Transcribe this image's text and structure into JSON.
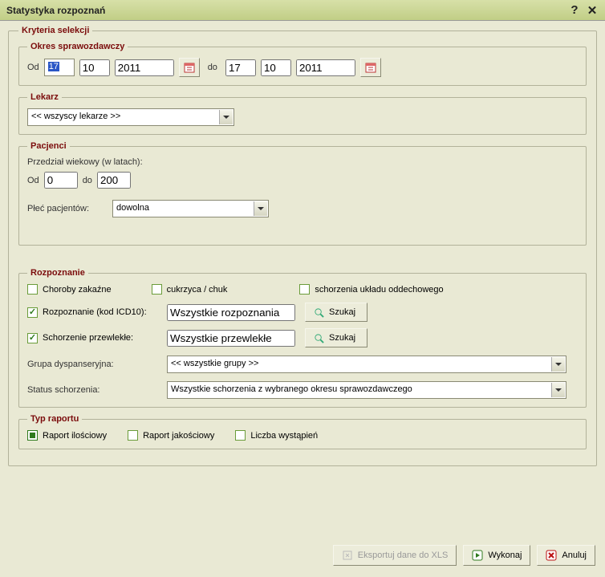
{
  "title": "Statystyka rozpoznań",
  "criteria_legend": "Kryteria selekcji",
  "period": {
    "legend": "Okres sprawozdawczy",
    "from_label": "Od",
    "to_label": "do",
    "from": {
      "d": "17",
      "m": "10",
      "y": "2011"
    },
    "to": {
      "d": "17",
      "m": "10",
      "y": "2011"
    }
  },
  "doctor": {
    "legend": "Lekarz",
    "selected": "<< wszyscy lekarze >>"
  },
  "patients": {
    "legend": "Pacjenci",
    "age_label": "Przedział wiekowy (w latach):",
    "from_label": "Od",
    "to_label": "do",
    "age_from": "0",
    "age_to": "200",
    "sex_label": "Płeć pacjentów:",
    "sex_selected": "dowolna"
  },
  "diagnosis": {
    "legend": "Rozpoznanie",
    "chk_infectious": "Choroby zakaźne",
    "chk_diabetes": "cukrzyca / chuk",
    "chk_respiratory": "schorzenia układu oddechowego",
    "chk_icd10": "Rozpoznanie (kod ICD10):",
    "icd10_value": "Wszystkie rozpoznania",
    "search_label": "Szukaj",
    "chk_chronic": "Schorzenie przewlekłe:",
    "chronic_value": "Wszystkie przewlekłe",
    "group_label": "Grupa dyspanseryjna:",
    "group_selected": "<< wszystkie grupy >>",
    "status_label": "Status schorzenia:",
    "status_selected": "Wszystkie schorzenia z wybranego okresu sprawozdawczego"
  },
  "report_type": {
    "legend": "Typ raportu",
    "quantitative": "Raport ilościowy",
    "qualitative": "Raport jakościowy",
    "occurrences": "Liczba wystąpień"
  },
  "buttons": {
    "export": "Eksportuj dane do XLS",
    "run": "Wykonaj",
    "cancel": "Anuluj"
  }
}
